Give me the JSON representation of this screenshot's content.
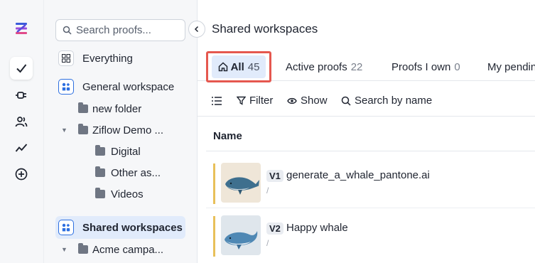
{
  "sidebar": {
    "search_placeholder": "Search proofs...",
    "items": [
      {
        "label": "Everything"
      },
      {
        "label": "General workspace"
      },
      {
        "label": "new folder"
      },
      {
        "label": "Ziflow Demo ..."
      },
      {
        "label": "Digital"
      },
      {
        "label": "Other as..."
      },
      {
        "label": "Videos"
      },
      {
        "label": "Shared workspaces"
      },
      {
        "label": "Acme campa..."
      }
    ]
  },
  "main": {
    "title": "Shared workspaces",
    "tabs": [
      {
        "label": "All",
        "count": "45"
      },
      {
        "label": "Active proofs",
        "count": "22"
      },
      {
        "label": "Proofs I own",
        "count": "0"
      },
      {
        "label": "My pendin"
      }
    ],
    "toolbar": {
      "filter": "Filter",
      "show": "Show",
      "search": "Search by name"
    },
    "column_name": "Name",
    "rows": [
      {
        "version": "V1",
        "name": "generate_a_whale_pantone.ai",
        "path": "/"
      },
      {
        "version": "V2",
        "name": "Happy whale",
        "path": "/"
      }
    ]
  },
  "colors": {
    "accent": "#2d6fe0",
    "highlight_box": "#e5584f",
    "selected_bg": "#e1ebfb",
    "status_bar": "#e8c05a"
  }
}
